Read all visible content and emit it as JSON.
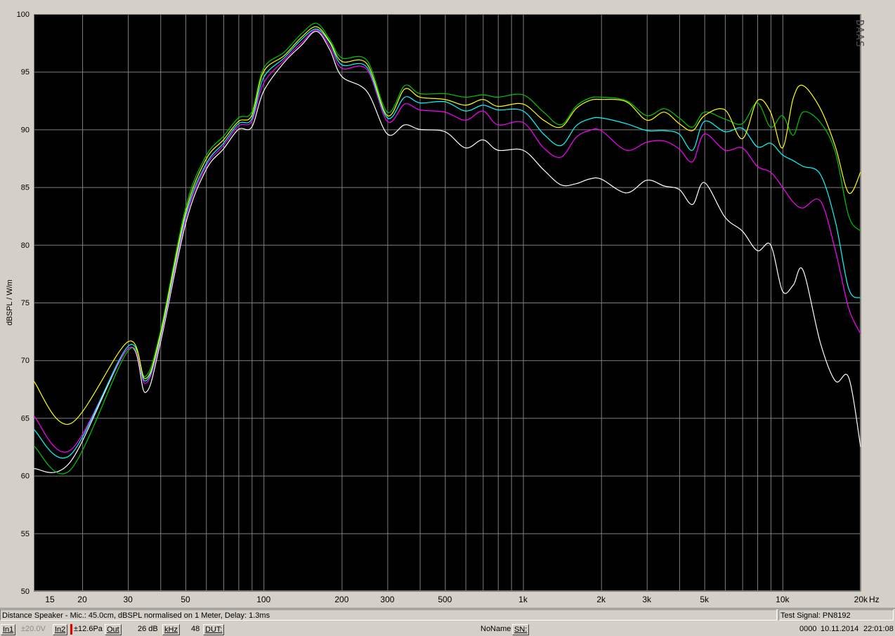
{
  "chart_data": {
    "type": "line",
    "xlabel": "Hz",
    "ylabel": "dBSPL / W/m",
    "x_scale": "log",
    "xlim": [
      13,
      20000
    ],
    "ylim": [
      50,
      100
    ],
    "grid": true,
    "background": "#000000",
    "grid_color": "#808080",
    "y_ticks": [
      50,
      55,
      60,
      65,
      70,
      75,
      80,
      85,
      90,
      95,
      100
    ],
    "y_tick_labels": [
      "50",
      "55",
      "60",
      "65",
      "70",
      "75",
      "80",
      "85",
      "90",
      "95",
      "100"
    ],
    "x_ticks": [
      15,
      20,
      30,
      50,
      100,
      200,
      300,
      500,
      1000,
      2000,
      3000,
      5000,
      10000,
      20000
    ],
    "x_tick_labels": [
      "15",
      "20",
      "30",
      "50",
      "100",
      "200",
      "300",
      "500",
      "1k",
      "2k",
      "3k",
      "5k",
      "10k",
      "20k"
    ],
    "logo_text": "DAAS",
    "series": [
      {
        "color": "#ffffff",
        "x": [
          13,
          18,
          30,
          35,
          40,
          50,
          60,
          70,
          80,
          90,
          100,
          120,
          140,
          160,
          180,
          200,
          250,
          300,
          350,
          400,
          500,
          600,
          700,
          800,
          1000,
          1200,
          1400,
          1600,
          1800,
          2000,
          2500,
          3000,
          3500,
          4000,
          4500,
          5000,
          6000,
          7000,
          8000,
          9000,
          10000,
          11000,
          12000,
          14000,
          16000,
          18000,
          20000
        ],
        "y": [
          60.6,
          61.2,
          71,
          67.2,
          71.5,
          81.8,
          86.5,
          88.3,
          90,
          90.2,
          93.3,
          95.8,
          97.3,
          98.5,
          96.9,
          94.6,
          93.3,
          89.6,
          90.4,
          90,
          89.8,
          88.4,
          89.1,
          88.2,
          88.2,
          86.5,
          85.2,
          85.3,
          85.7,
          85.7,
          84.5,
          85.6,
          85.1,
          84.8,
          83.5,
          85.4,
          82.4,
          81.2,
          79.5,
          80,
          76,
          76.5,
          77.8,
          71.5,
          68.2,
          68.5,
          62.5
        ]
      },
      {
        "color": "#ff00ff",
        "x": [
          13,
          18,
          30,
          35,
          40,
          50,
          60,
          70,
          80,
          90,
          100,
          120,
          140,
          160,
          180,
          200,
          250,
          300,
          350,
          400,
          500,
          600,
          700,
          800,
          1000,
          1200,
          1400,
          1600,
          1800,
          2000,
          2500,
          3000,
          3500,
          4000,
          4500,
          5000,
          6000,
          7000,
          8000,
          9000,
          10000,
          11000,
          12000,
          14000,
          16000,
          18000,
          20000
        ],
        "y": [
          65.2,
          62.2,
          71,
          68,
          71.8,
          82.2,
          86.8,
          88.6,
          90.3,
          90.7,
          94,
          96,
          97.5,
          98.6,
          97.2,
          95.3,
          95.2,
          90.7,
          92.2,
          91.7,
          91.5,
          90.8,
          91.6,
          90.4,
          90.6,
          88.4,
          87.6,
          89.3,
          89.9,
          89.9,
          88.2,
          88.9,
          89,
          88.3,
          87.2,
          89.6,
          88.2,
          88.4,
          86.8,
          86.3,
          85,
          83.7,
          83.2,
          83.8,
          79.5,
          74.5,
          72.3
        ]
      },
      {
        "color": "#00ffff",
        "x": [
          13,
          18,
          30,
          35,
          40,
          50,
          60,
          70,
          80,
          90,
          100,
          120,
          140,
          160,
          180,
          200,
          250,
          300,
          350,
          400,
          500,
          600,
          700,
          800,
          1000,
          1200,
          1400,
          1600,
          1800,
          2000,
          2500,
          3000,
          3500,
          4000,
          4500,
          5000,
          6000,
          7000,
          8000,
          9000,
          10000,
          11000,
          12000,
          14000,
          16000,
          18000,
          20000
        ],
        "y": [
          64,
          61.8,
          71.2,
          68.2,
          72,
          82.5,
          87,
          88.8,
          90.5,
          90.9,
          94.5,
          96.2,
          97.8,
          98.7,
          97.5,
          95.6,
          95.4,
          91,
          92.8,
          92.3,
          92.4,
          91.6,
          92.1,
          91.7,
          91.6,
          89.6,
          88.6,
          90.3,
          90.9,
          91,
          90.5,
          89.9,
          89.9,
          89.6,
          88.2,
          90.7,
          89.8,
          90.1,
          88.5,
          88.8,
          87.8,
          87.3,
          86.8,
          86.1,
          82,
          76.2,
          75.4
        ]
      },
      {
        "color": "#00c800",
        "x": [
          13,
          18,
          30,
          35,
          40,
          50,
          60,
          70,
          80,
          90,
          100,
          120,
          140,
          160,
          180,
          200,
          250,
          300,
          350,
          400,
          500,
          600,
          700,
          800,
          1000,
          1200,
          1400,
          1600,
          1800,
          2000,
          2500,
          3000,
          3500,
          4000,
          4500,
          5000,
          6000,
          7000,
          8000,
          9000,
          10000,
          11000,
          12000,
          14000,
          16000,
          18000,
          20000
        ],
        "y": [
          62.6,
          60.5,
          70.8,
          68.6,
          72.5,
          83.2,
          87.7,
          89.4,
          91,
          91.5,
          95.3,
          96.7,
          98.3,
          99.2,
          97.8,
          96.2,
          96,
          91.5,
          93.8,
          93.1,
          93.1,
          92.8,
          93,
          92.8,
          93,
          91.5,
          90.4,
          92,
          92.7,
          92.8,
          92.5,
          91.2,
          91.8,
          91,
          90.2,
          91.5,
          90.9,
          90.5,
          92.3,
          90.2,
          91.2,
          89.5,
          91.5,
          90.6,
          88,
          82.5,
          81.2
        ]
      },
      {
        "color": "#ffff00",
        "x": [
          13,
          18,
          30,
          35,
          40,
          50,
          60,
          70,
          80,
          90,
          100,
          120,
          140,
          160,
          180,
          200,
          250,
          300,
          350,
          400,
          500,
          600,
          700,
          800,
          1000,
          1200,
          1400,
          1600,
          1800,
          2000,
          2500,
          3000,
          3500,
          4000,
          4500,
          5000,
          6000,
          7000,
          8000,
          9000,
          10000,
          11000,
          12000,
          14000,
          16000,
          18000,
          20000
        ],
        "y": [
          68.2,
          64.5,
          71.6,
          68.4,
          72.2,
          82.8,
          87.4,
          89.1,
          90.7,
          91.2,
          95,
          96.4,
          98,
          98.9,
          97.6,
          95.9,
          95.7,
          91.2,
          93.5,
          92.8,
          92.6,
          92.1,
          92.6,
          92,
          92.2,
          90.8,
          90.2,
          91.8,
          92.5,
          92.6,
          92.4,
          90.8,
          91.5,
          90.5,
          89.9,
          91.2,
          91.7,
          89.2,
          92.5,
          91.5,
          88.4,
          92.7,
          93.8,
          91.8,
          88.5,
          84.5,
          86.3
        ]
      }
    ]
  },
  "status": {
    "description": "Distance Speaker - Mic.: 45.0cm, dBSPL normalised on 1 Meter, Delay: 1.3ms",
    "test_signal": "Test Signal: PN8192"
  },
  "toolbar": {
    "in1": "In1",
    "in1_range": "±20.0V",
    "in2": "In2",
    "in2_range": "±12.6Pa",
    "out": "Out",
    "gain": "26 dB",
    "khz": "kHz",
    "rate": "48",
    "dut": "DUT:",
    "name": "NoName",
    "sn": "SN:",
    "counter": "0000",
    "date": "10.11.2014",
    "time": "22:01:08"
  }
}
